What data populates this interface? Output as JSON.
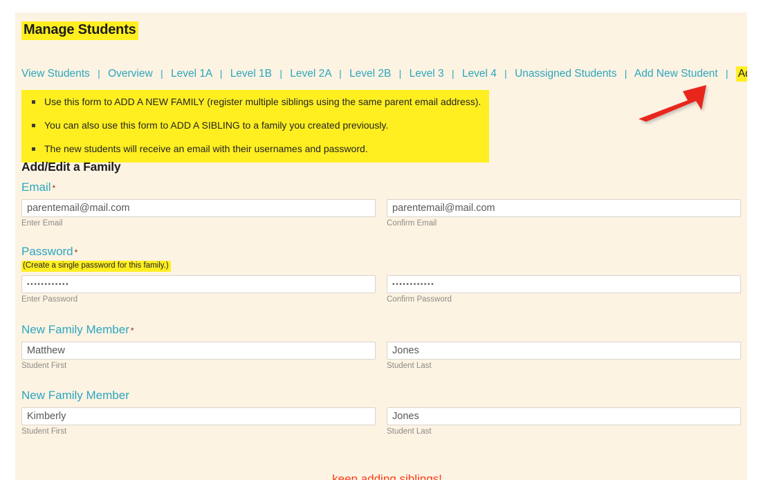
{
  "page": {
    "title": "Manage Students",
    "background_color": "#fdf3e3",
    "highlight_color": "#ffef20",
    "link_color": "#2ba6bd",
    "accent_red": "#fa3c14"
  },
  "nav": {
    "separator": "|",
    "items": [
      {
        "label": "View Students",
        "highlighted": false
      },
      {
        "label": "Overview",
        "highlighted": false
      },
      {
        "label": "Level 1A",
        "highlighted": false
      },
      {
        "label": "Level 1B",
        "highlighted": false
      },
      {
        "label": "Level 2A",
        "highlighted": false
      },
      {
        "label": "Level 2B",
        "highlighted": false
      },
      {
        "label": "Level 3",
        "highlighted": false
      },
      {
        "label": "Level 4",
        "highlighted": false
      },
      {
        "label": "Unassigned Students",
        "highlighted": false
      },
      {
        "label": "Add New Student",
        "highlighted": false
      },
      {
        "label": "Add/Edit a Family",
        "highlighted": true
      }
    ]
  },
  "instructions": {
    "bullets": [
      "Use this form to ADD A NEW FAMILY (register multiple siblings using the same parent email address).",
      "You can also use this form to ADD A SIBLING to a family you created previously.",
      "The new students will receive an email with their usernames and password."
    ]
  },
  "form": {
    "heading": "Add/Edit a Family",
    "required_marker": "*",
    "groups": [
      {
        "label": "Email",
        "required": true,
        "note": "",
        "fields": [
          {
            "value": "parentemail@mail.com",
            "placeholder": "",
            "sublabel": "Enter Email",
            "type": "text"
          },
          {
            "value": "parentemail@mail.com",
            "placeholder": "",
            "sublabel": "Confirm Email",
            "type": "text"
          }
        ]
      },
      {
        "label": "Password",
        "required": true,
        "note": "(Create a single password for this family.)",
        "fields": [
          {
            "value": "••••••••••••",
            "placeholder": "",
            "sublabel": "Enter Password",
            "type": "password"
          },
          {
            "value": "••••••••••••",
            "placeholder": "",
            "sublabel": "Confirm Password",
            "type": "password"
          }
        ]
      },
      {
        "label": "New Family Member",
        "required": true,
        "note": "",
        "fields": [
          {
            "value": "Matthew",
            "placeholder": "",
            "sublabel": "Student First",
            "type": "text"
          },
          {
            "value": "Jones",
            "placeholder": "",
            "sublabel": "Student Last",
            "type": "text"
          }
        ]
      },
      {
        "label": "New Family Member",
        "required": false,
        "note": "",
        "fields": [
          {
            "value": "Kimberly",
            "placeholder": "",
            "sublabel": "Student First",
            "type": "text"
          },
          {
            "value": "Jones",
            "placeholder": "",
            "sublabel": "Student Last",
            "type": "text"
          }
        ]
      }
    ]
  },
  "footer": {
    "note": "…keep adding siblings!"
  },
  "annotation": {
    "arrow": {
      "name": "red-arrow-annotation",
      "color": "#e8281c",
      "points_to": "Add/Edit a Family"
    }
  }
}
